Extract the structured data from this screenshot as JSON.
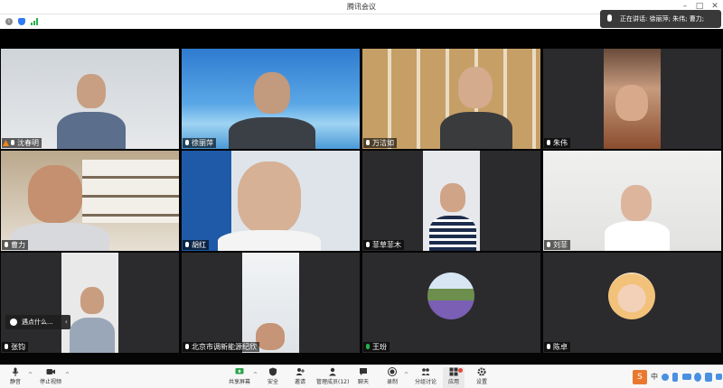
{
  "window": {
    "title": "腾讯会议"
  },
  "speaking": {
    "text": "正在讲话: 徐丽萍; 朱伟; 曹力;"
  },
  "tiles": [
    {
      "name": "沈春明",
      "host": true,
      "bg": "#d9dde2"
    },
    {
      "name": "徐丽萍",
      "host": false,
      "bg": "#3e8fd6"
    },
    {
      "name": "万洁如",
      "host": false,
      "bg": "#c8a56a"
    },
    {
      "name": "朱伟",
      "host": false,
      "bg": "#2b2b2d"
    },
    {
      "name": "曹力",
      "host": false,
      "bg": "#b9a68b"
    },
    {
      "name": "胡红",
      "host": false,
      "bg": "#cfd5de"
    },
    {
      "name": "菲草菲木",
      "host": false,
      "bg": "#2b2b2d"
    },
    {
      "name": "刘菲",
      "host": false,
      "bg": "#efefee"
    },
    {
      "name": "张钧",
      "host": false,
      "bg": "#2b2b2d"
    },
    {
      "name": "北京市调新能源纪欣",
      "host": false,
      "bg": "#2b2b2d"
    },
    {
      "name": "王玢",
      "host": false,
      "bg": "#2b2b2d"
    },
    {
      "name": "陈卓",
      "host": false,
      "bg": "#2b2b2d"
    }
  ],
  "toast": {
    "text": "遇点什么..."
  },
  "toolbar": {
    "mute": "静音",
    "stop_video": "停止视频",
    "share_screen": "共享屏幕",
    "security": "安全",
    "invite": "邀请",
    "manage_members": "管理成员(12)",
    "chat": "聊天",
    "record": "录制",
    "breakout": "分组讨论",
    "apps": "应用",
    "settings": "设置"
  },
  "tray": {
    "ime": "S",
    "lang": "中"
  },
  "colors": {
    "accent": "#2f7bf5",
    "signal": "#27b24a",
    "host": "#f0861d"
  }
}
